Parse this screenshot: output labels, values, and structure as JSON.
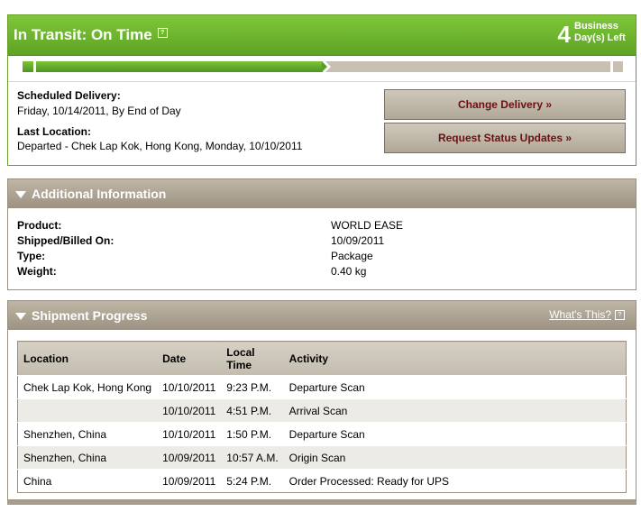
{
  "status": {
    "title": "In Transit: On Time",
    "days_number": "4",
    "days_label_line1": "Business",
    "days_label_line2": "Day(s) Left",
    "progress_fraction": 0.5,
    "scheduled_label": "Scheduled Delivery:",
    "scheduled_value": "Friday, 10/14/2011, By End of Day",
    "location_label": "Last Location:",
    "location_value": "Departed - Chek Lap Kok, Hong Kong, Monday, 10/10/2011",
    "change_button": "Change Delivery »",
    "request_button": "Request Status Updates »",
    "accent_color": "#5ea424",
    "button_text_color": "#6b1010"
  },
  "additional": {
    "title": "Additional Information",
    "rows": [
      {
        "label": "Product:",
        "value": "WORLD EASE"
      },
      {
        "label": "Shipped/Billed On:",
        "value": "10/09/2011"
      },
      {
        "label": "Type:",
        "value": "Package"
      },
      {
        "label": "Weight:",
        "value": "0.40 kg"
      }
    ]
  },
  "progress": {
    "title": "Shipment Progress",
    "whats_this": "What's This?",
    "columns": [
      "Location",
      "Date",
      "Local Time",
      "Activity"
    ],
    "column_time_line1": "Local",
    "column_time_line2": "Time",
    "rows": [
      {
        "location": "Chek Lap Kok, Hong Kong",
        "date": "10/10/2011",
        "time": "9:23 P.M.",
        "activity": "Departure Scan"
      },
      {
        "location": "",
        "date": "10/10/2011",
        "time": "4:51 P.M.",
        "activity": "Arrival Scan"
      },
      {
        "location": "Shenzhen, China",
        "date": "10/10/2011",
        "time": "1:50 P.M.",
        "activity": "Departure Scan"
      },
      {
        "location": "Shenzhen, China",
        "date": "10/09/2011",
        "time": "10:57 A.M.",
        "activity": "Origin Scan"
      },
      {
        "location": "China",
        "date": "10/09/2011",
        "time": "5:24 P.M.",
        "activity": "Order Processed: Ready for UPS"
      }
    ]
  }
}
